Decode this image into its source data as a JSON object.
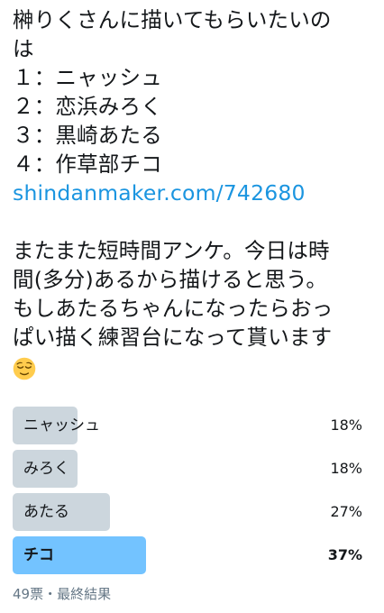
{
  "tweet": {
    "lines": [
      "榊りくさんに描いてもらいたいの",
      "は",
      "１：ニャッシュ",
      "２：恋浜みろく",
      "３：黒崎あたる",
      "４：作草部チコ"
    ],
    "link": "shindanmaker.com/742680",
    "body_lines": [
      "またまた短時間アンケ。今日は時",
      "間(多分)あるから描けると思う。",
      "もしあたるちゃんになったらおっ",
      "ぱい描く練習台になって貰います"
    ],
    "emoji": "relieved-face-emoji"
  },
  "poll": {
    "options": [
      {
        "label": "ニャッシュ",
        "percent": 18,
        "winner": false,
        "percent_text": "18%"
      },
      {
        "label": "みろく",
        "percent": 18,
        "winner": false,
        "percent_text": "18%"
      },
      {
        "label": "あたる",
        "percent": 27,
        "winner": false,
        "percent_text": "27%"
      },
      {
        "label": "チコ",
        "percent": 37,
        "winner": true,
        "percent_text": "37%"
      }
    ],
    "footer": "49票・最終結果"
  },
  "colors": {
    "link": "#1b95e0",
    "bar": "#ccd6dd",
    "bar_winner": "#73c3ff",
    "muted": "#657786"
  }
}
